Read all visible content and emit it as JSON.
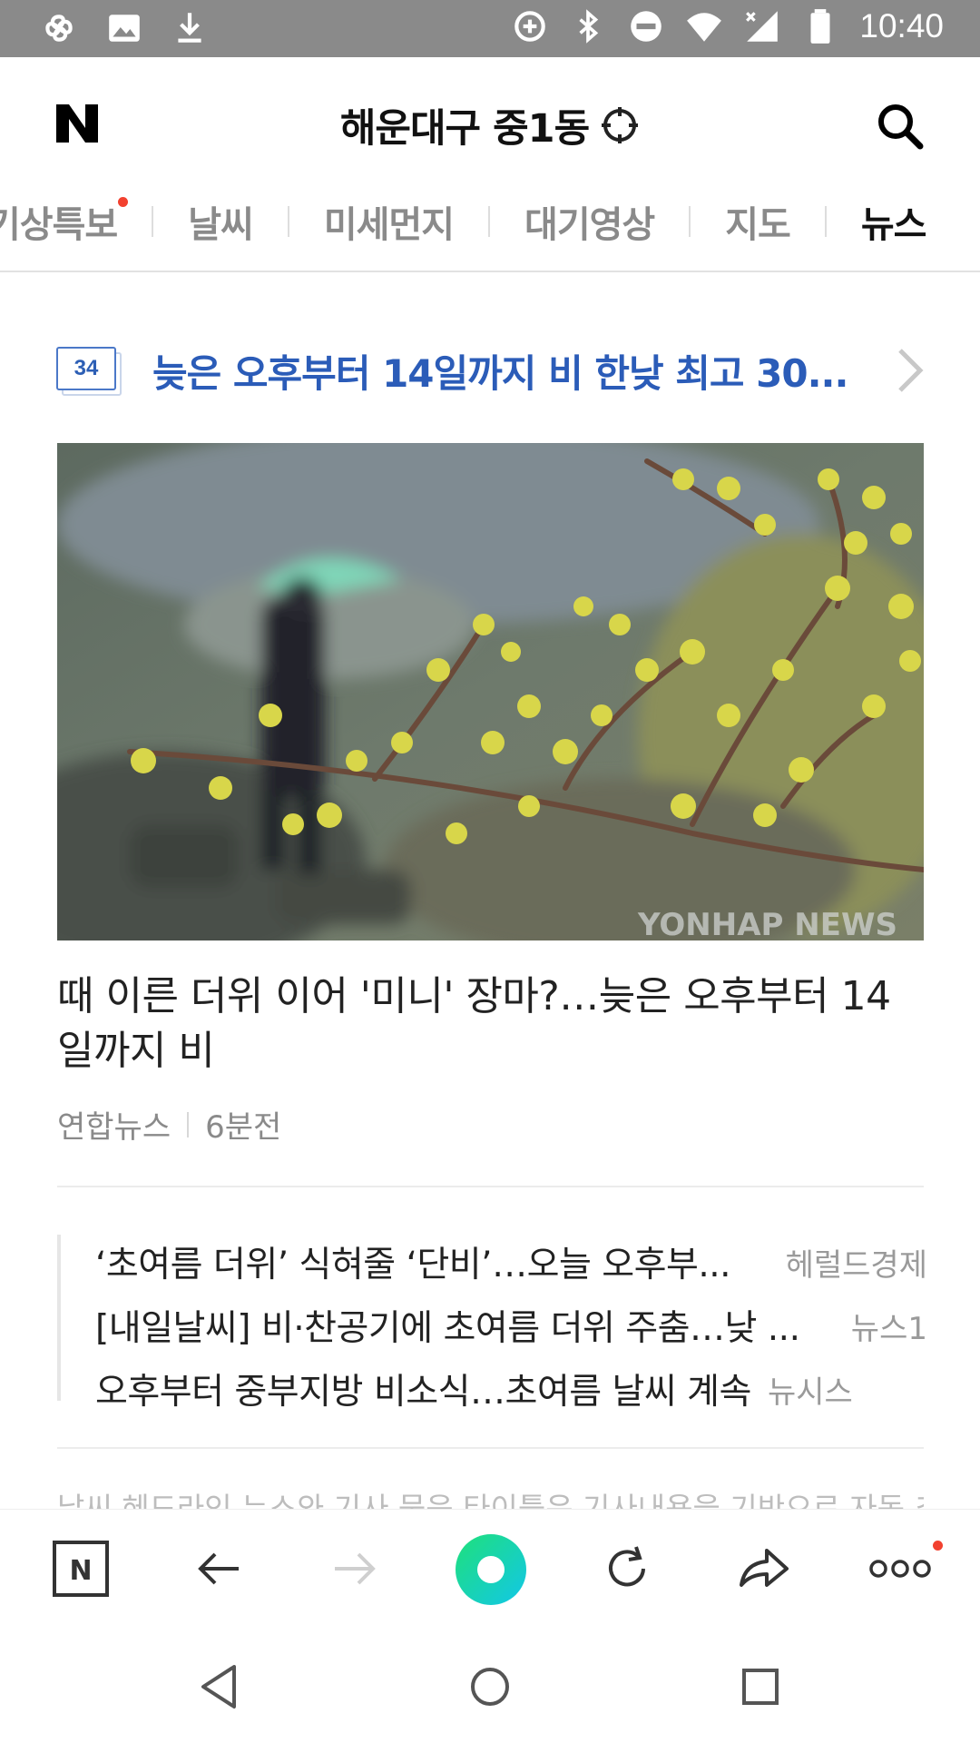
{
  "status_bar": {
    "time": "10:40",
    "left_icons": [
      "pinwheel-icon",
      "image-icon",
      "download-icon"
    ],
    "right_icons": [
      "data-saver-icon",
      "bluetooth-icon",
      "do-not-disturb-icon",
      "wifi-icon",
      "signal-icon",
      "battery-icon"
    ]
  },
  "header": {
    "logo": "N",
    "location": "해운대구 중1동"
  },
  "tabs": [
    {
      "label": "기상특보",
      "has_dot": true
    },
    {
      "label": "날씨"
    },
    {
      "label": "미세먼지"
    },
    {
      "label": "대기영상"
    },
    {
      "label": "지도"
    },
    {
      "label": "뉴스",
      "active": true
    }
  ],
  "alert": {
    "badge": "34",
    "text": "늦은 오후부터 14일까지 비 한낮 최고 30..."
  },
  "photo": {
    "watermark": "YONHAP NEWS"
  },
  "article": {
    "headline": "때 이른 더위 이어 '미니' 장마?…늦은 오후부터 14일까지 비",
    "source": "연합뉴스",
    "time": "6분전"
  },
  "related": [
    {
      "title": "‘초여름 더위’ 식혀줄 ‘단비’…오늘 오후부...",
      "source": "헤럴드경제"
    },
    {
      "title": "[내일날씨] 비·찬공기에 초여름 더위 주춤…낮 ...",
      "source": "뉴스1"
    },
    {
      "title": "오후부터 중부지방 비소식…초여름 날씨 계속",
      "source": "뉴시스"
    }
  ],
  "footer_cut_text": "날씨 헤드라인 뉴스와 기사 묶음 타이틀은 기사내용을 기반으로 자동 추출된",
  "toolbar": {
    "home_label": "N",
    "accent": "#1fe07a"
  }
}
